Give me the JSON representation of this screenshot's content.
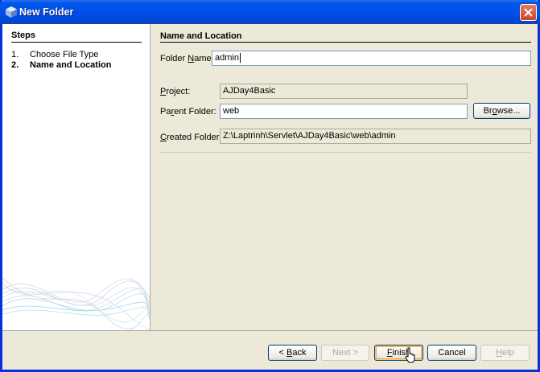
{
  "window": {
    "title": "New Folder",
    "close_glyph": "close-icon"
  },
  "steps": {
    "title": "Steps",
    "items": [
      {
        "num": "1.",
        "label": "Choose File Type",
        "current": false
      },
      {
        "num": "2.",
        "label": "Name and Location",
        "current": true
      }
    ]
  },
  "main": {
    "section_title": "Name and Location",
    "folder_name": {
      "label_prefix": "Folder ",
      "label_mnemonic": "N",
      "label_suffix": "ame:",
      "value": "admin"
    },
    "project": {
      "label_mnemonic": "P",
      "label_suffix": "roject:",
      "value": "AJDay4Basic"
    },
    "parent_folder": {
      "label_prefix": "Pa",
      "label_mnemonic": "r",
      "label_suffix": "ent Folder:",
      "value": "web"
    },
    "browse_button": {
      "prefix": "Br",
      "mnemonic": "o",
      "suffix": "wse..."
    },
    "created_folder": {
      "label_mnemonic": "C",
      "label_suffix": "reated Folder:",
      "value": "Z:\\Laptrinh\\Servlet\\AJDay4Basic\\web\\admin"
    }
  },
  "buttons": {
    "back": {
      "prefix": "< ",
      "mnemonic": "B",
      "suffix": "ack"
    },
    "next": {
      "label": "Next >"
    },
    "finish": {
      "mnemonic": "F",
      "suffix": "inish"
    },
    "cancel": {
      "label": "Cancel"
    },
    "help": {
      "mnemonic": "H",
      "suffix": "elp"
    }
  },
  "colors": {
    "title_bar": "#0055e5",
    "window_border": "#0831d9",
    "dialog_bg": "#ece9d8",
    "field_border": "#7f9db9"
  }
}
